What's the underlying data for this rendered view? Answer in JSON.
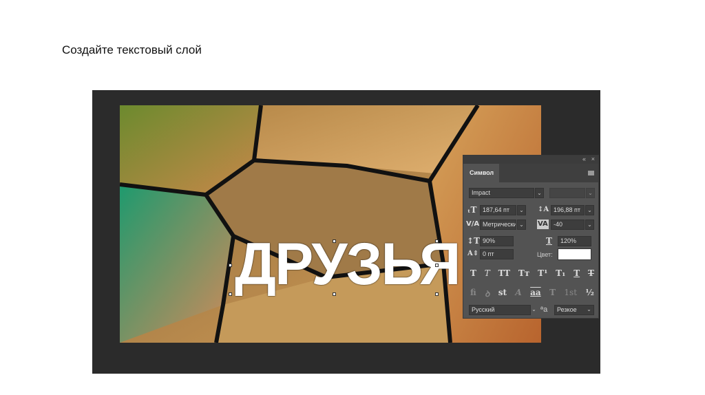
{
  "slide": {
    "heading": "Создайте текстовый слой"
  },
  "canvas": {
    "layer_text": "ДРУЗЬЯ"
  },
  "panel": {
    "collapse_icon": "«",
    "close_icon": "×",
    "tab": "Символ",
    "font_family": "Impact",
    "font_style": "",
    "font_size": "187,64 пт",
    "leading": "196,88 пт",
    "kerning": "Метрически",
    "tracking": "-40",
    "vertical_scale": "90%",
    "horizontal_scale": "120%",
    "baseline_shift": "0 пт",
    "color_label": "Цвет:",
    "color_value": "#ffffff",
    "style_buttons": [
      "T",
      "T",
      "TT",
      "Tт",
      "T¹",
      "T₁",
      "T",
      "T"
    ],
    "opentype_buttons": [
      "fi",
      "ꝺ",
      "st",
      "A",
      "aa",
      "T",
      "1st",
      "½"
    ],
    "language": "Русский",
    "aa_icon": "ªa",
    "antialias": "Резкое",
    "chevron": "⌄"
  }
}
